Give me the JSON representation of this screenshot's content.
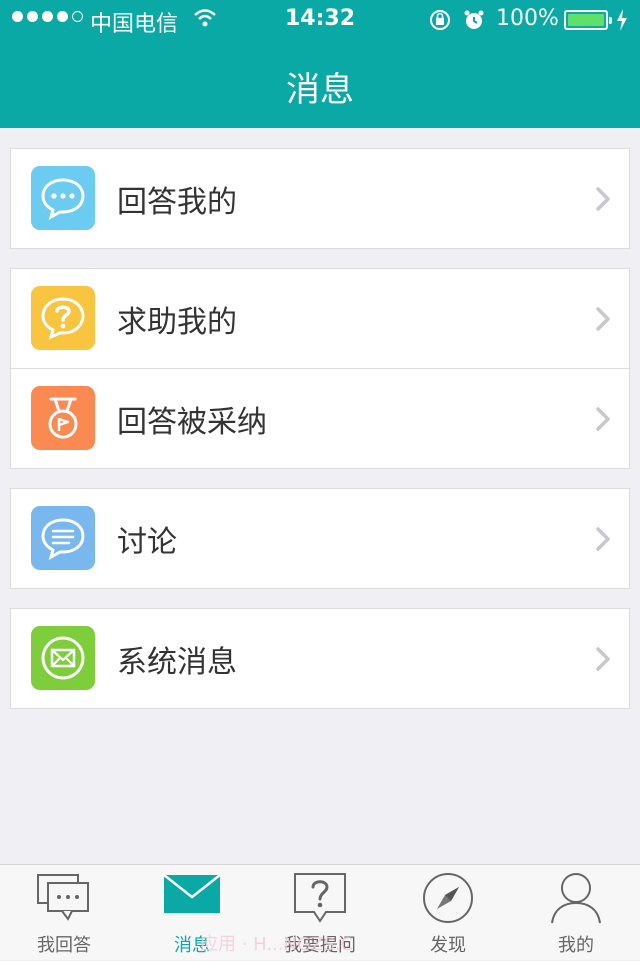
{
  "status_bar": {
    "carrier": "中国电信",
    "time": "14:32",
    "battery": "100%"
  },
  "nav": {
    "title": "消息"
  },
  "groups": [
    {
      "items": [
        {
          "label": "回答我的",
          "icon": "chat-bubble-icon",
          "color": "#6ccbf0"
        }
      ]
    },
    {
      "items": [
        {
          "label": "求助我的",
          "icon": "question-bubble-icon",
          "color": "#f9c440"
        },
        {
          "label": "回答被采纳",
          "icon": "medal-icon",
          "color": "#fb8a52"
        }
      ]
    },
    {
      "items": [
        {
          "label": "讨论",
          "icon": "discussion-icon",
          "color": "#79b7ef"
        }
      ]
    },
    {
      "items": [
        {
          "label": "系统消息",
          "icon": "envelope-icon",
          "color": "#7dce3a"
        }
      ]
    }
  ],
  "tabs": [
    {
      "label": "我回答",
      "icon": "chat-bubbles-icon",
      "active": false
    },
    {
      "label": "消息",
      "icon": "envelope-icon",
      "active": true
    },
    {
      "label": "我要提问",
      "icon": "question-icon",
      "active": false
    },
    {
      "label": "发现",
      "icon": "compass-icon",
      "active": false
    },
    {
      "label": "我的",
      "icon": "user-icon",
      "active": false
    }
  ],
  "watermark": "应用 · H...NGZS.C",
  "colors": {
    "brand": "#0aa9a6",
    "background": "#efeff4"
  }
}
